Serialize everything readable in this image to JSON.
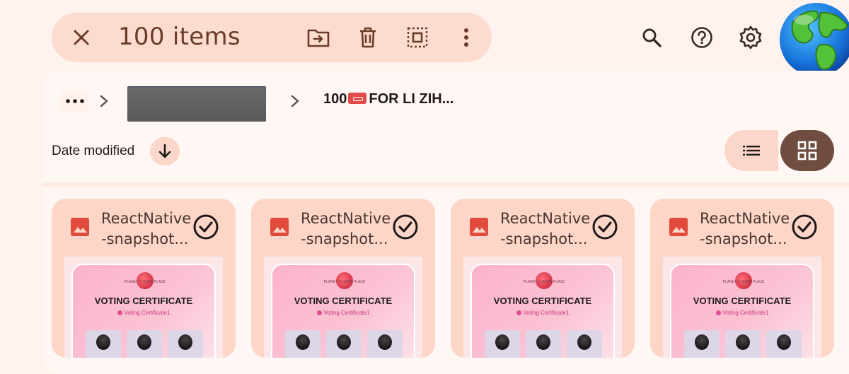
{
  "selection_bar": {
    "count_label": "100 items",
    "actions": [
      "close-icon",
      "move-to-folder-icon",
      "delete-icon",
      "select-all-icon",
      "more-vert-icon"
    ]
  },
  "header_actions": [
    "search-icon",
    "help-icon",
    "settings-icon",
    "globe-avatar"
  ],
  "breadcrumb": {
    "folder_prefix": "100",
    "folder_suffix": "FOR LI ZIH..."
  },
  "sort": {
    "label": "Date modified",
    "direction": "descending"
  },
  "view_mode": {
    "options": [
      "list",
      "grid"
    ],
    "selected": "grid"
  },
  "files": [
    {
      "name_line1": "ReactNative",
      "name_line2": "-snapshot...",
      "selected": true,
      "thumb_title": "VOTING CERTIFICATE",
      "thumb_sub": "Voting Certificate1",
      "thumb_logo": "PLANET C HOME PLACE"
    },
    {
      "name_line1": "ReactNative",
      "name_line2": "-snapshot...",
      "selected": true,
      "thumb_title": "VOTING CERTIFICATE",
      "thumb_sub": "Voting Certificate1",
      "thumb_logo": "PLANET C HOME PLACE"
    },
    {
      "name_line1": "ReactNative",
      "name_line2": "-snapshot...",
      "selected": true,
      "thumb_title": "VOTING CERTIFICATE",
      "thumb_sub": "Voting Certificate1",
      "thumb_logo": "PLANET C HOME PLACE"
    },
    {
      "name_line1": "ReactNative",
      "name_line2": "-snapshot...",
      "selected": true,
      "thumb_title": "VOTING CERTIFICATE",
      "thumb_sub": "Voting Certificate1",
      "thumb_logo": "PLANET C HOME PLACE"
    }
  ],
  "colors": {
    "background": "#fff3ef",
    "accent_container": "#fddcd0",
    "selected_view": "#6f4d40",
    "image_icon": "#e14b3b"
  }
}
